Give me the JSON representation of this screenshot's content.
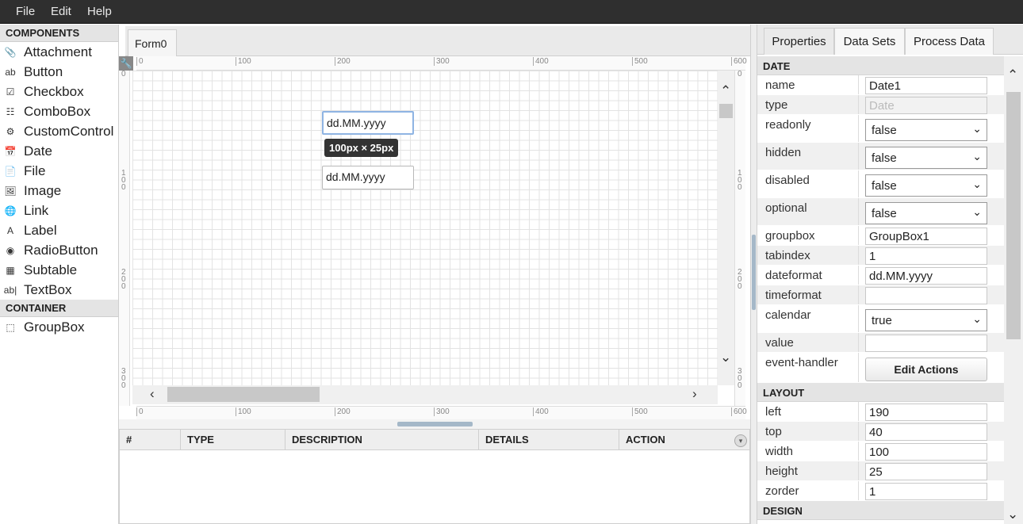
{
  "menu": [
    "File",
    "Edit",
    "Help"
  ],
  "components": {
    "header": "COMPONENTS",
    "items": [
      {
        "label": "Attachment",
        "icon": "paperclip-icon"
      },
      {
        "label": "Button",
        "icon": "button-icon"
      },
      {
        "label": "Checkbox",
        "icon": "checkbox-icon"
      },
      {
        "label": "ComboBox",
        "icon": "combobox-icon"
      },
      {
        "label": "CustomControl",
        "icon": "custom-control-icon"
      },
      {
        "label": "Date",
        "icon": "calendar-icon"
      },
      {
        "label": "File",
        "icon": "file-icon"
      },
      {
        "label": "Image",
        "icon": "image-icon"
      },
      {
        "label": "Link",
        "icon": "globe-icon"
      },
      {
        "label": "Label",
        "icon": "label-icon"
      },
      {
        "label": "RadioButton",
        "icon": "radio-icon"
      },
      {
        "label": "Subtable",
        "icon": "table-icon"
      },
      {
        "label": "TextBox",
        "icon": "textbox-icon"
      }
    ],
    "container_header": "CONTAINER",
    "container_items": [
      {
        "label": "GroupBox",
        "icon": "groupbox-icon"
      }
    ]
  },
  "designer": {
    "tab": "Form0",
    "ruler_h": [
      "0",
      "100",
      "200",
      "300",
      "400",
      "500",
      "600"
    ],
    "ruler_v": [
      "0",
      "100",
      "200",
      "300"
    ],
    "fields": [
      {
        "value": "dd.MM.yyyy",
        "selected": true
      },
      {
        "value": "dd.MM.yyyy",
        "selected": false
      }
    ],
    "size_tooltip": "100px × 25px"
  },
  "issues": {
    "columns": [
      "#",
      "TYPE",
      "DESCRIPTION",
      "DETAILS",
      "ACTION"
    ]
  },
  "properties": {
    "tabs": [
      "Properties",
      "Data Sets",
      "Process Data"
    ],
    "active_tab": "Properties",
    "sections": [
      {
        "title": "DATE",
        "rows": [
          {
            "label": "name",
            "kind": "input",
            "value": "Date1"
          },
          {
            "label": "type",
            "kind": "disabled",
            "value": "Date"
          },
          {
            "label": "readonly",
            "kind": "select",
            "value": "false"
          },
          {
            "label": "hidden",
            "kind": "select",
            "value": "false"
          },
          {
            "label": "disabled",
            "kind": "select",
            "value": "false"
          },
          {
            "label": "optional",
            "kind": "select",
            "value": "false"
          },
          {
            "label": "groupbox",
            "kind": "input",
            "value": "GroupBox1"
          },
          {
            "label": "tabindex",
            "kind": "input",
            "value": "1"
          },
          {
            "label": "dateformat",
            "kind": "input",
            "value": "dd.MM.yyyy"
          },
          {
            "label": "timeformat",
            "kind": "input",
            "value": ""
          },
          {
            "label": "calendar",
            "kind": "select",
            "value": "true"
          },
          {
            "label": "value",
            "kind": "input",
            "value": ""
          },
          {
            "label": "event-handler",
            "kind": "button",
            "value": "Edit Actions"
          }
        ]
      },
      {
        "title": "LAYOUT",
        "rows": [
          {
            "label": "left",
            "kind": "input",
            "value": "190"
          },
          {
            "label": "top",
            "kind": "input",
            "value": "40"
          },
          {
            "label": "width",
            "kind": "input",
            "value": "100"
          },
          {
            "label": "height",
            "kind": "input",
            "value": "25"
          },
          {
            "label": "zorder",
            "kind": "input",
            "value": "1"
          }
        ]
      },
      {
        "title": "DESIGN",
        "rows": []
      }
    ]
  }
}
